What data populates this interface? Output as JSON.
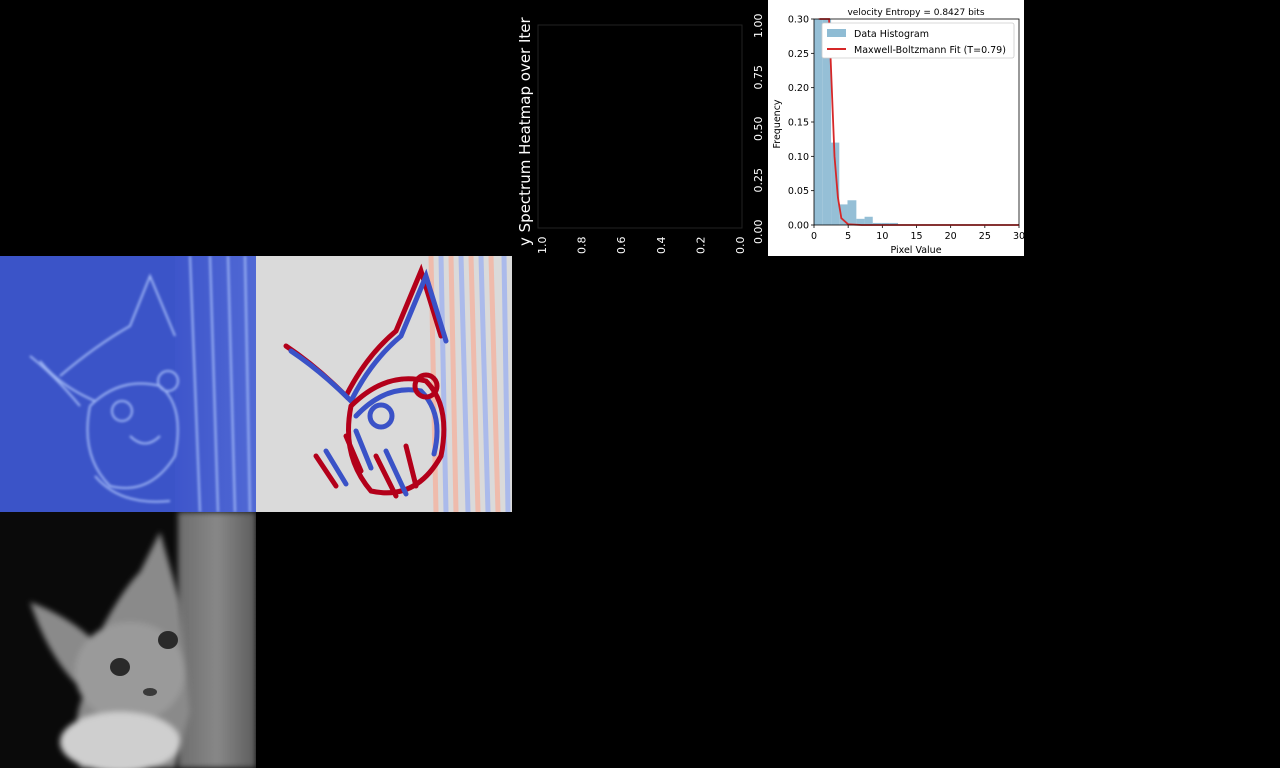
{
  "spectrum_panel": {
    "title_fragment": "y Spectrum Heatmap over Iter",
    "bottom_ticks": [
      "1.0",
      "0.8",
      "0.6",
      "0.4",
      "0.2",
      "0.0"
    ],
    "right_ticks": [
      "0.00",
      "0.25",
      "0.50",
      "0.75",
      "1.00"
    ]
  },
  "chart_data": {
    "type": "bar",
    "title": "velocity Entropy = 0.8427 bits",
    "xlabel": "Pixel Value",
    "ylabel": "Frequency",
    "xlim": [
      0,
      30
    ],
    "ylim": [
      0,
      0.3
    ],
    "xticks": [
      "0",
      "5",
      "10",
      "15",
      "20",
      "25",
      "30"
    ],
    "yticks": [
      "0.00",
      "0.05",
      "0.10",
      "0.15",
      "0.20",
      "0.25",
      "0.30"
    ],
    "histogram": {
      "name": "Data Histogram",
      "color": "#8fbcd4",
      "bins": [
        {
          "x0": 0.0,
          "x1": 1.2,
          "value": 0.3
        },
        {
          "x0": 1.2,
          "x1": 2.5,
          "value": 0.3
        },
        {
          "x0": 2.5,
          "x1": 3.7,
          "value": 0.12
        },
        {
          "x0": 3.7,
          "x1": 4.9,
          "value": 0.03
        },
        {
          "x0": 4.9,
          "x1": 6.2,
          "value": 0.036
        },
        {
          "x0": 6.2,
          "x1": 7.4,
          "value": 0.009
        },
        {
          "x0": 7.4,
          "x1": 8.6,
          "value": 0.012
        },
        {
          "x0": 8.6,
          "x1": 9.9,
          "value": 0.003
        },
        {
          "x0": 9.9,
          "x1": 11.1,
          "value": 0.003
        },
        {
          "x0": 11.1,
          "x1": 12.3,
          "value": 0.003
        }
      ]
    },
    "fit": {
      "name": "Maxwell-Boltzmann Fit (T=0.79)",
      "color": "#d62728",
      "x": [
        0.8,
        1.2,
        1.6,
        2.0,
        2.2,
        2.6,
        3.0,
        3.5,
        4.0,
        5.0,
        7.0,
        10.0,
        15.0,
        20.0,
        25.0,
        30.0
      ],
      "y": [
        0.3,
        0.3,
        0.3,
        0.3,
        0.3,
        0.2,
        0.1,
        0.04,
        0.01,
        0.001,
        0,
        0,
        0,
        0,
        0,
        0
      ]
    },
    "legend": "top-right",
    "grid": false
  }
}
